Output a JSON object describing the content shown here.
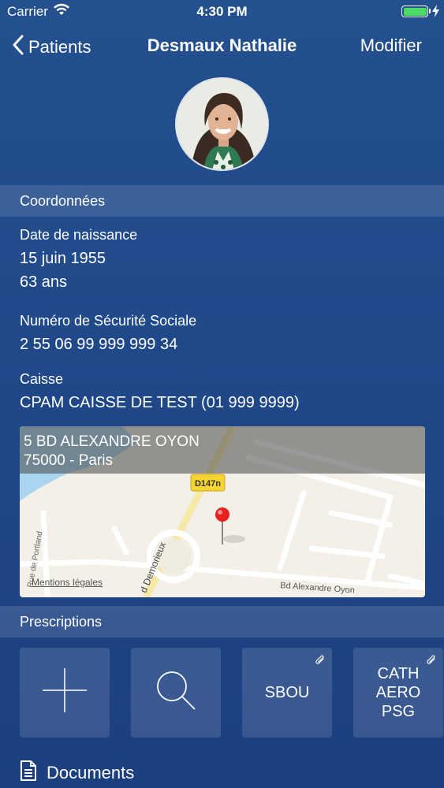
{
  "status_bar": {
    "carrier": "Carrier",
    "time": "4:30 PM"
  },
  "nav": {
    "back_label": "Patients",
    "title": "Desmaux Nathalie",
    "edit_label": "Modifier"
  },
  "coordonnees": {
    "header": "Coordonnées",
    "birth_label": "Date de naissance",
    "birth_date": "15 juin 1955",
    "age": "63 ans",
    "ssn_label": "Numéro de Sécurité Sociale",
    "ssn_value": "2 55 06 99 999 999 34",
    "caisse_label": "Caisse",
    "caisse_value": "CPAM CAISSE DE TEST (01 999 9999)"
  },
  "map": {
    "address_line1": "5 BD ALEXANDRE OYON",
    "address_line2": "75000 - Paris",
    "road_badge": "D147n",
    "street_label_main": "Bd Alexandre Oyon",
    "street_label_diag": "d Demorieux",
    "street_label_vertical": "Rue de Portland",
    "legal_link": "Mentions légales"
  },
  "prescriptions": {
    "header": "Prescriptions",
    "tiles": [
      {
        "type": "add",
        "icon": "plus-icon"
      },
      {
        "type": "search",
        "icon": "magnifier-icon"
      },
      {
        "type": "item",
        "label": "SBOU",
        "attachment": true
      },
      {
        "type": "item",
        "label_lines": [
          "CATH",
          "AERO",
          "PSG"
        ],
        "attachment": true
      }
    ]
  },
  "documents": {
    "label": "Documents",
    "icon": "document-icon"
  },
  "colors": {
    "background": "#20498a",
    "battery": "#4cd964",
    "pin": "#e5221d",
    "road_badge": "#f6d432"
  }
}
